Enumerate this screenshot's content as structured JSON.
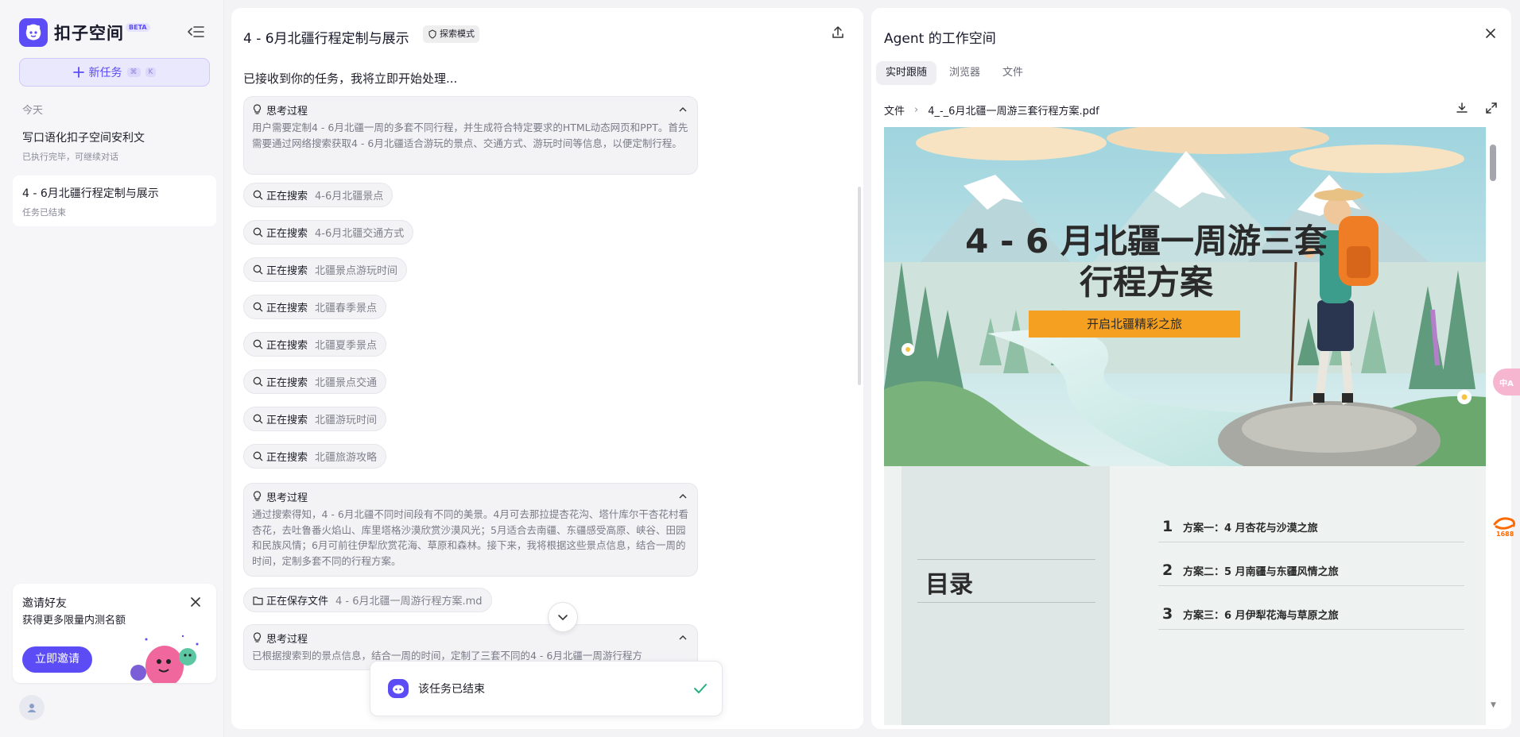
{
  "sidebar": {
    "brand": "扣子空间",
    "beta": "BETA",
    "new_task": "新任务",
    "shortcut_a": "⌘",
    "shortcut_b": "K",
    "section_today": "今天",
    "tasks": [
      {
        "title": "写口语化扣子空间安利文",
        "subtitle": "已执行完毕，可继续对话"
      },
      {
        "title": "4 - 6月北疆行程定制与展示",
        "subtitle": "任务已结束"
      }
    ],
    "invite": {
      "title": "邀请好友",
      "subtitle": "获得更多限量内测名额",
      "button": "立即邀请"
    }
  },
  "chat": {
    "title": "4 - 6月北疆行程定制与展示",
    "mode_badge": "探索模式",
    "received": "已接收到你的任务，我将立即开始处理...",
    "think_label": "思考过程",
    "think_1": "用户需要定制4 - 6月北疆一周的多套不同行程，并生成符合特定要求的HTML动态网页和PPT。首先需要通过网络搜索获取4 - 6月北疆适合游玩的景点、交通方式、游玩时间等信息，以便定制行程。",
    "search_label": "正在搜索",
    "searches": [
      "4-6月北疆景点",
      "4-6月北疆交通方式",
      "北疆景点游玩时间",
      "北疆春季景点",
      "北疆夏季景点",
      "北疆景点交通",
      "北疆游玩时间",
      "北疆旅游攻略"
    ],
    "think_2": "通过搜索得知，4 - 6月北疆不同时间段有不同的美景。4月可去那拉提杏花沟、塔什库尔干杏花村看杏花，去吐鲁番火焰山、库里塔格沙漠欣赏沙漠风光；5月适合去南疆、东疆感受高原、峡谷、田园和民族风情；6月可前往伊犁欣赏花海、草原和森林。接下来，我将根据这些景点信息，结合一周的时间，定制多套不同的行程方案。",
    "save_label": "正在保存文件",
    "save_file": "4 - 6月北疆一周游行程方案.md",
    "think_3": "已根据搜索到的景点信息，结合一周的时间，定制了三套不同的4 - 6月北疆一周游行程方",
    "finished": "该任务已结束"
  },
  "workspace": {
    "title": "Agent 的工作空间",
    "tabs": [
      "实时跟随",
      "浏览器",
      "文件"
    ],
    "path_root": "文件",
    "path_file": "4_-_6月北疆一周游三套行程方案.pdf",
    "slide1_title_line1": "4 - 6 月北疆一周游三套",
    "slide1_title_line2": "行程方案",
    "slide1_button": "开启北疆精彩之旅",
    "toc_title": "目录",
    "toc": [
      {
        "num": "1",
        "text": "方案一：4 月杏花与沙漠之旅"
      },
      {
        "num": "2",
        "text": "方案二：5 月南疆与东疆风情之旅"
      },
      {
        "num": "3",
        "text": "方案三：6 月伊犁花海与草原之旅"
      }
    ]
  },
  "floating": {
    "translate": "中A",
    "ali": "1688"
  },
  "colors": {
    "accent": "#5b4cf5",
    "orange": "#f5a020"
  }
}
